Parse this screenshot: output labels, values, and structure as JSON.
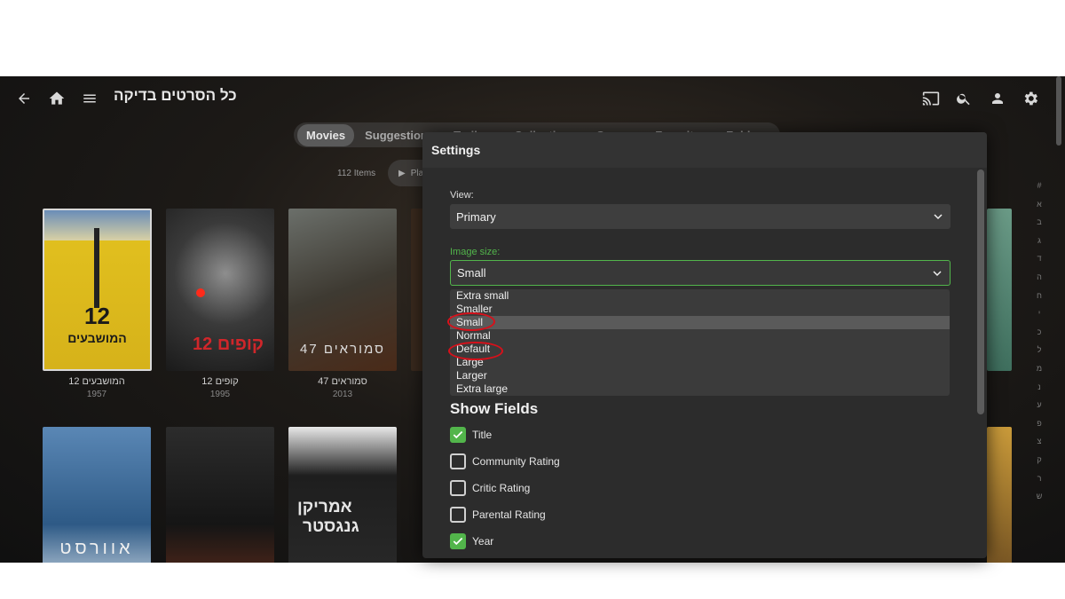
{
  "header": {
    "title": "כל הסרטים בדיקה",
    "icons": [
      "back-arrow-icon",
      "home-icon",
      "menu-icon",
      "cast-icon",
      "search-icon",
      "user-icon",
      "gear-icon"
    ]
  },
  "tabs": [
    {
      "label": "Movies",
      "active": true
    },
    {
      "label": "Suggestions",
      "active": false
    },
    {
      "label": "Trailers",
      "active": false
    },
    {
      "label": "Collections",
      "active": false
    },
    {
      "label": "Genres",
      "active": false
    },
    {
      "label": "Favorites",
      "active": false
    },
    {
      "label": "Folders",
      "active": false
    }
  ],
  "toolbar": {
    "items_count": "112 Items",
    "play_label": "Pla"
  },
  "movies": [
    {
      "title": "12 המושבעים",
      "year": "1957"
    },
    {
      "title": "12 קופים",
      "year": "1995"
    },
    {
      "title": "47 סמוראים",
      "year": "2013"
    }
  ],
  "alphabet": [
    "#",
    "א",
    "ב",
    "ג",
    "ד",
    "ה",
    "ח",
    "י",
    "כ",
    "ל",
    "מ",
    "נ",
    "ע",
    "פ",
    "צ",
    "ק",
    "ר",
    "ש"
  ],
  "settings_dialog": {
    "title": "Settings",
    "view": {
      "label": "View:",
      "value": "Primary"
    },
    "image_size": {
      "label": "Image size:",
      "value": "Small",
      "options": [
        "Extra small",
        "Smaller",
        "Small",
        "Normal",
        "Default",
        "Large",
        "Larger",
        "Extra large"
      ],
      "highlighted": "Small",
      "circled": [
        "Small",
        "Default"
      ]
    },
    "show_fields": {
      "heading": "Show Fields",
      "fields": [
        {
          "label": "Title",
          "checked": true
        },
        {
          "label": "Community Rating",
          "checked": false
        },
        {
          "label": "Critic Rating",
          "checked": false
        },
        {
          "label": "Parental Rating",
          "checked": false
        },
        {
          "label": "Year",
          "checked": true
        }
      ]
    }
  },
  "colors": {
    "accent": "#52b54b",
    "annotation": "#d8101a",
    "dialog_bg": "#2c2c2c"
  }
}
